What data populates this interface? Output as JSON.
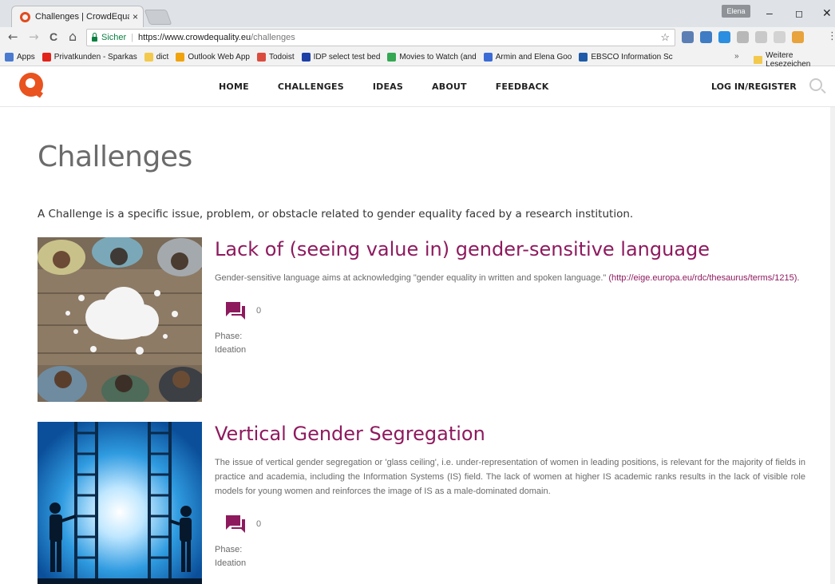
{
  "browser": {
    "tab_title": "Challenges | CrowdEquality",
    "tab_close": "×",
    "user_badge": "Elena",
    "controls": {
      "minimize": "–",
      "maximize": "◻",
      "close": "✕"
    },
    "nav": {
      "back": "←",
      "forward": "→",
      "reload": "C",
      "home": "⌂"
    },
    "secure_label": "Sicher",
    "url_separator": "|",
    "url_base": "https://www.crowdequality.eu",
    "url_path": "/challenges",
    "star": "☆",
    "menu": "⋮",
    "bookmarks": [
      {
        "label": "Apps",
        "color": "#4a7bd0"
      },
      {
        "label": "Privatkunden - Sparkas",
        "color": "#e2231a"
      },
      {
        "label": "dict",
        "color": "#f2c94c"
      },
      {
        "label": "Outlook Web App",
        "color": "#f0a30a"
      },
      {
        "label": "Todoist",
        "color": "#db4c3f"
      },
      {
        "label": "IDP select test bed",
        "color": "#1d3fa6"
      },
      {
        "label": "Movies to Watch (and",
        "color": "#34a853"
      },
      {
        "label": "Armin and Elena Goo",
        "color": "#3b6bd6"
      },
      {
        "label": "EBSCO Information Sc",
        "color": "#1e5aa8"
      }
    ],
    "bookmarks_more": "»",
    "bookmarks_folder": "Weitere Lesezeichen"
  },
  "site": {
    "nav": [
      {
        "label": "HOME"
      },
      {
        "label": "CHALLENGES"
      },
      {
        "label": "IDEAS"
      },
      {
        "label": "ABOUT"
      },
      {
        "label": "FEEDBACK"
      }
    ],
    "login": "LOG IN/REGISTER",
    "accent_color": "#8e1a5e",
    "logo_color": "#e8531f"
  },
  "page": {
    "title": "Challenges",
    "intro": "A Challenge is a specific issue, problem, or obstacle related to gender equality faced by a research institution."
  },
  "challenges": [
    {
      "title": "Lack of (seeing value in) gender-sensitive language",
      "desc": "Gender-sensitive language aims at acknowledging \"gender equality in written and spoken language.\"",
      "link": "(http://eige.europa.eu/rdc/thesaurus/terms/1215).",
      "comments": "0",
      "phase_label": "Phase:",
      "phase_value": "Ideation"
    },
    {
      "title": "Vertical Gender Segregation",
      "desc": "The issue of vertical gender segregation or 'glass ceiling', i.e. under-representation of women in leading positions, is relevant for the majority of fields in practice and academia, including the Information Systems (IS) field. The lack of women at higher IS academic ranks results in the lack of visible role models for young women and reinforces the image of IS as a male-dominated domain.",
      "link": "",
      "comments": "0",
      "phase_label": "Phase:",
      "phase_value": "Ideation"
    }
  ]
}
